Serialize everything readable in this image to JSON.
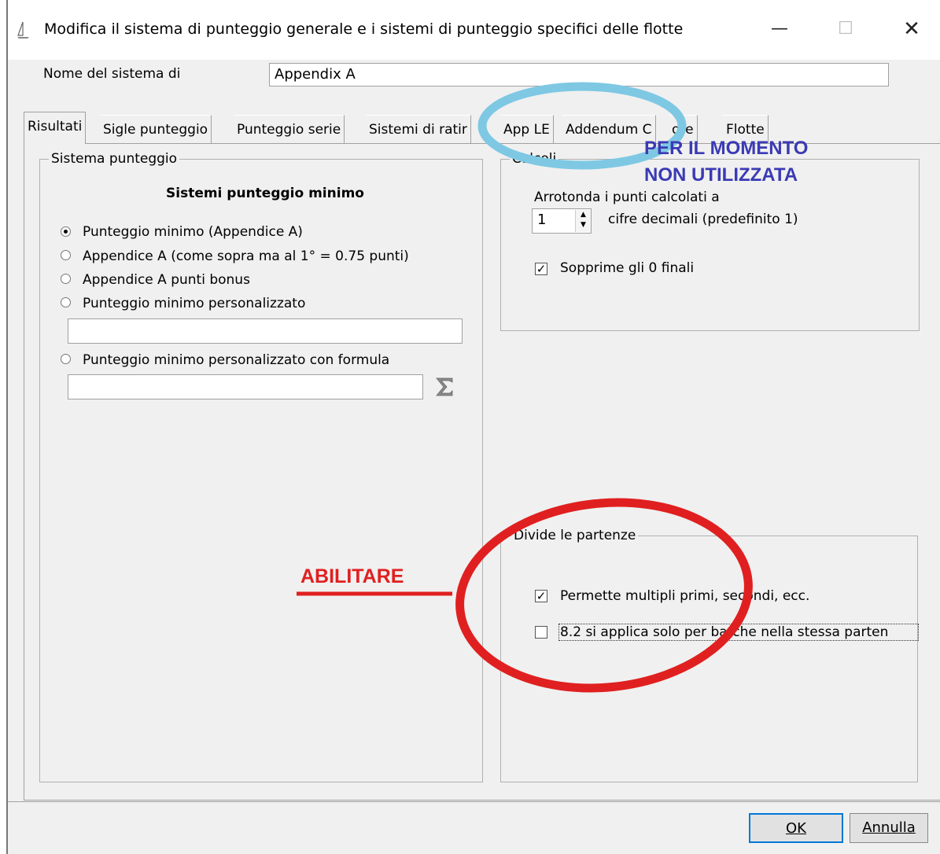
{
  "window": {
    "title": "Modifica il sistema di punteggio generale e i sistemi di punteggio specifici delle flotte",
    "minimize": "—",
    "maximize": "☐",
    "close": "✕"
  },
  "name_field": {
    "label": "Nome del sistema di",
    "value": "Appendix A"
  },
  "tabs": [
    {
      "label": "Risultati",
      "accel": "R",
      "active": true
    },
    {
      "label": "Sigle punteggio",
      "active": false
    },
    {
      "label": "Punteggio serie",
      "active": false
    },
    {
      "label": "Sistemi di ratir",
      "active": false
    },
    {
      "label": "App LE",
      "active": false
    },
    {
      "label": "Addendum C",
      "active": false
    },
    {
      "label": "ote",
      "active": false
    },
    {
      "label": "Flotte",
      "active": false
    }
  ],
  "scoring_group": {
    "legend": "Sistema punteggio",
    "heading": "Sistemi punteggio minimo",
    "options": [
      {
        "label": "Punteggio minimo (Appendice A)",
        "selected": true
      },
      {
        "label": "Appendice A (come sopra ma al 1° = 0.75 punti)",
        "selected": false
      },
      {
        "label": "Appendice A punti bonus",
        "selected": false
      },
      {
        "label": "Punteggio minimo personalizzato",
        "selected": false
      },
      {
        "label": "Punteggio minimo personalizzato con formula",
        "selected": false
      }
    ],
    "custom_value": "",
    "formula_value": "",
    "formula_icon": "sigma-icon"
  },
  "calc_group": {
    "legend": "Calcoli",
    "round_label": "Arrotonda i punti calcolati a",
    "decimals_value": "1",
    "decimals_suffix": "cifre decimali (predefinito 1)",
    "suppress_label": "Sopprime gli 0 finali",
    "suppress_checked": true
  },
  "split_group": {
    "legend": "Divide le partenze",
    "multi_label": "Permette multipli primi, secondi, ecc.",
    "multi_checked": true,
    "rule_label": "8.2 si applica solo per barche nella stessa parten",
    "rule_checked": false
  },
  "buttons": {
    "ok": "OK",
    "cancel": "Annulla"
  },
  "annotations": {
    "blue_line1": "PER IL MOMENTO",
    "blue_line2": "NON UTILIZZATA",
    "red_text": "ABILITARE",
    "blue_color": "#7ec8e3",
    "red_color": "#e02020"
  }
}
